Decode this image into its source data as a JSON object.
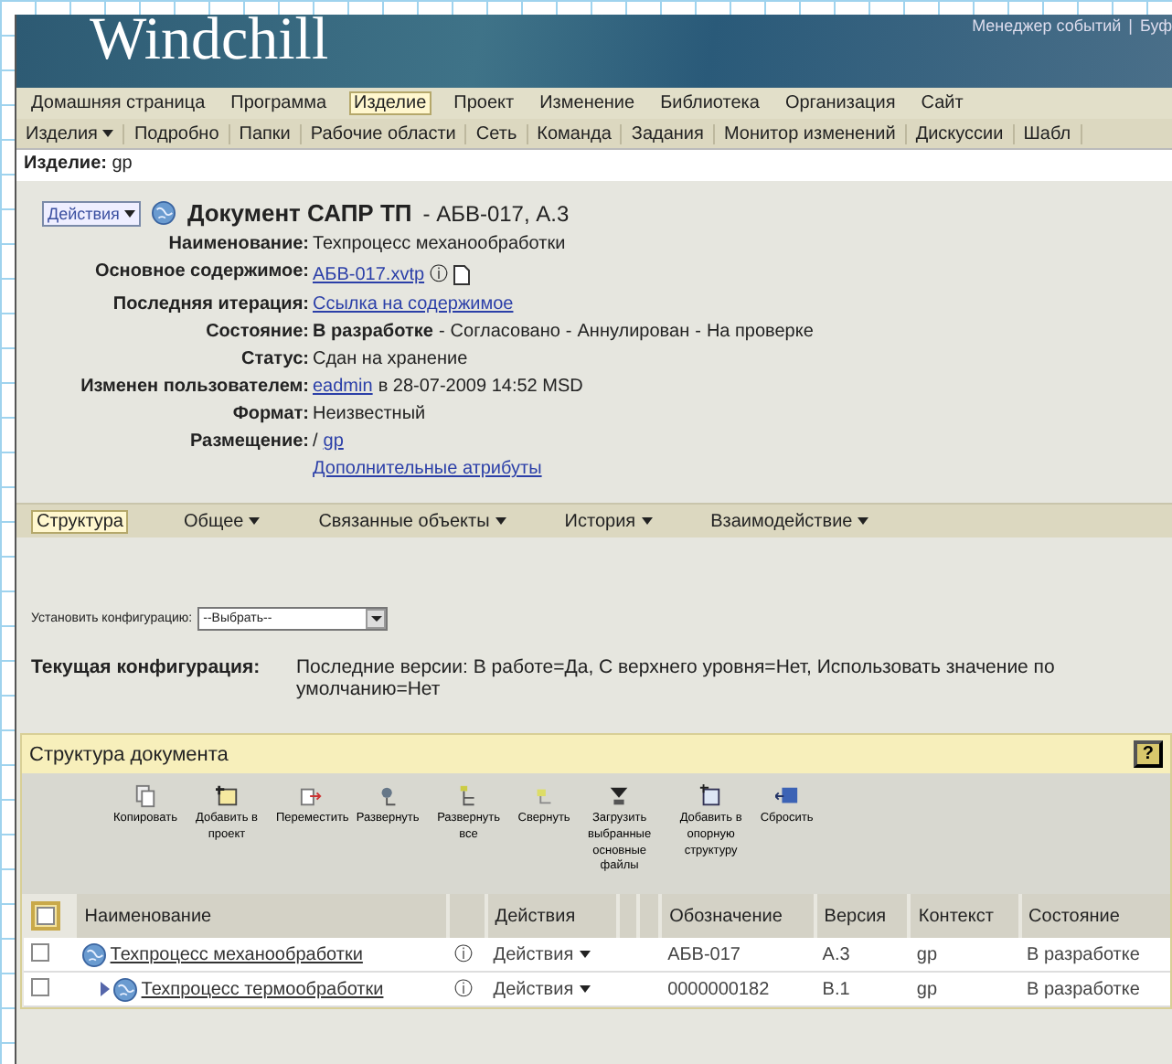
{
  "header": {
    "logo": "Windchill",
    "links": [
      "Менеджер событий",
      "Буф"
    ],
    "separator": "|"
  },
  "main_menu": [
    {
      "label": "Домашняя страница",
      "selected": false
    },
    {
      "label": "Программа",
      "selected": false
    },
    {
      "label": "Изделие",
      "selected": true
    },
    {
      "label": "Проект",
      "selected": false
    },
    {
      "label": "Изменение",
      "selected": false
    },
    {
      "label": "Библиотека",
      "selected": false
    },
    {
      "label": "Организация",
      "selected": false
    },
    {
      "label": "Сайт",
      "selected": false
    }
  ],
  "sub_menu": [
    {
      "label": "Изделия",
      "has_menu": true
    },
    {
      "label": "Подробно",
      "has_menu": false
    },
    {
      "label": "Папки",
      "has_menu": false
    },
    {
      "label": "Рабочие области",
      "has_menu": false
    },
    {
      "label": "Сеть",
      "has_menu": false
    },
    {
      "label": "Команда",
      "has_menu": false
    },
    {
      "label": "Задания",
      "has_menu": false
    },
    {
      "label": "Монитор изменений",
      "has_menu": false
    },
    {
      "label": "Дискуссии",
      "has_menu": false
    },
    {
      "label": "Шабл",
      "has_menu": false
    }
  ],
  "context": {
    "label": "Изделие:",
    "value": "gp"
  },
  "document": {
    "actions": "Действия",
    "title": "Документ САПР ТП",
    "subtitle": "- АБВ-017, А.3",
    "attributes": [
      {
        "label": "Наименование:",
        "kind": "text",
        "value": "Техпроцесс механообработки"
      },
      {
        "label": "Основное содержимое:",
        "kind": "file",
        "link": "АБВ-017.xvtp",
        "info": "ⓘ"
      },
      {
        "label": "Последняя итерация:",
        "kind": "link",
        "link": "Ссылка на содержимое"
      },
      {
        "label": "Состояние:",
        "kind": "states",
        "separator": "-",
        "states": [
          {
            "label": "В разработке",
            "selected": true
          },
          {
            "label": "Согласовано",
            "selected": false
          },
          {
            "label": "Аннулирован",
            "selected": false
          },
          {
            "label": "На проверке",
            "selected": false
          }
        ]
      },
      {
        "label": "Статус:",
        "kind": "text",
        "value": "Сдан на хранение"
      },
      {
        "label": "Изменен пользователем:",
        "kind": "user",
        "link": "eadmin",
        "value": "в 28-07-2009 14:52 MSD"
      },
      {
        "label": "Формат:",
        "kind": "text",
        "value": "Неизвестный"
      },
      {
        "label": "Размещение:",
        "kind": "path",
        "value": "/",
        "link": "gp"
      },
      {
        "kind": "more",
        "link": "Дополнительные атрибуты"
      }
    ]
  },
  "tabs": [
    {
      "label": "Структура",
      "selected": true,
      "has_menu": false
    },
    {
      "label": "Общее",
      "selected": false,
      "has_menu": true
    },
    {
      "label": "Связанные объекты",
      "selected": false,
      "has_menu": true
    },
    {
      "label": "История",
      "selected": false,
      "has_menu": true
    },
    {
      "label": "Взаимодействие",
      "selected": false,
      "has_menu": true
    }
  ],
  "configuration": {
    "label": "Установить конфигурацию:",
    "select": "--Выбрать--",
    "current_label": "Текущая конфигурация:",
    "current_value": "Последние версии: В работе=Да, С верхнего уровня=Нет, Использовать значение по умолчанию=Нет"
  },
  "structure": {
    "title": "Структура документа",
    "help": "?",
    "toolbar": [
      {
        "label": "Копировать",
        "kind": "copy"
      },
      {
        "label": "Добавить в проект",
        "kind": "add-project"
      },
      {
        "label": "Переместить",
        "kind": "move"
      },
      {
        "label": "Развернуть",
        "kind": "expand"
      },
      {
        "label": "Развернуть все",
        "kind": "expand-all"
      },
      {
        "label": "Свернуть",
        "kind": "collapse"
      },
      {
        "label": "Загрузить выбранные основные файлы",
        "kind": "download"
      },
      {
        "label": "Добавить в опорную структуру",
        "kind": "add-structure"
      },
      {
        "label": "Сбросить",
        "kind": "reset"
      }
    ],
    "select_all": {
      "checked": false
    },
    "columns": [
      {
        "kind": "name",
        "label": "Наименование"
      },
      {
        "kind": "blank"
      },
      {
        "kind": "actions",
        "label": "Действия"
      },
      {
        "kind": "blank"
      },
      {
        "kind": "blank"
      },
      {
        "kind": "number",
        "label": "Обозначение"
      },
      {
        "kind": "version",
        "label": "Версия"
      },
      {
        "kind": "context",
        "label": "Контекст"
      },
      {
        "kind": "state",
        "label": "Состояние"
      }
    ],
    "rows": [
      {
        "checked": false,
        "name": "Техпроцесс механообработки",
        "info": "ⓘ",
        "actions": "Действия",
        "number": "АБВ-017",
        "version": "А.3",
        "context": "gp",
        "state": "В разработке",
        "children": [
          {
            "checked": false,
            "expanded": false,
            "name": "Техпроцесс термообработки",
            "info": "ⓘ",
            "actions": "Действия",
            "number": "0000000182",
            "version": "В.1",
            "context": "gp",
            "state": "В разработке"
          }
        ]
      }
    ]
  }
}
